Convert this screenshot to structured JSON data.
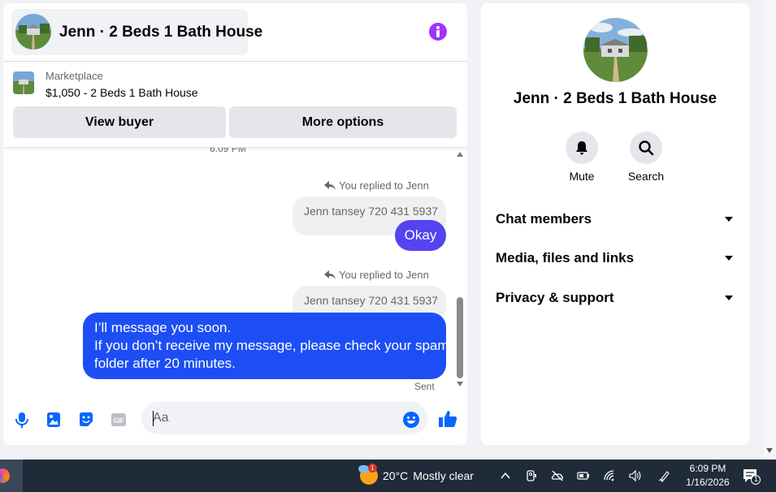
{
  "header": {
    "title": "Jenn · 2 Beds 1 Bath House"
  },
  "listing": {
    "source_label": "Marketplace",
    "title": "$1,050 - 2 Beds 1 Bath House",
    "view_buyer_label": "View buyer",
    "more_options_label": "More options"
  },
  "messages": {
    "time_separator": "6:09 PM",
    "reply_note_1": "You replied to Jenn",
    "quote_1": "Jenn tansey 720 431 5937",
    "message_1": "Okay",
    "reply_note_2": "You replied to Jenn",
    "quote_2": "Jenn tansey 720 431 5937",
    "message_2_lines": [
      "I’ll message you soon.",
      "If you don’t receive my message, please check your spam",
      "folder after 20 minutes."
    ],
    "status": "Sent"
  },
  "composer": {
    "placeholder": "Aa"
  },
  "info_panel": {
    "title": "Jenn · 2 Beds 1 Bath House",
    "mute_label": "Mute",
    "search_label": "Search",
    "sections": [
      {
        "label": "Chat members"
      },
      {
        "label": "Media, files and links"
      },
      {
        "label": "Privacy & support"
      }
    ]
  },
  "taskbar": {
    "weather_temp": "20°C",
    "weather_desc": "Mostly clear",
    "weather_badge": "1",
    "time": "6:09 PM",
    "date": "1/16/2026",
    "notification_count": "1"
  },
  "colors": {
    "accent_purple": "#a033ff",
    "bubble_okay": "#5443f0",
    "bubble_long": "#1d4ef5",
    "messenger_blue": "#0866ff",
    "taskbar_bg": "#1f2b38"
  }
}
